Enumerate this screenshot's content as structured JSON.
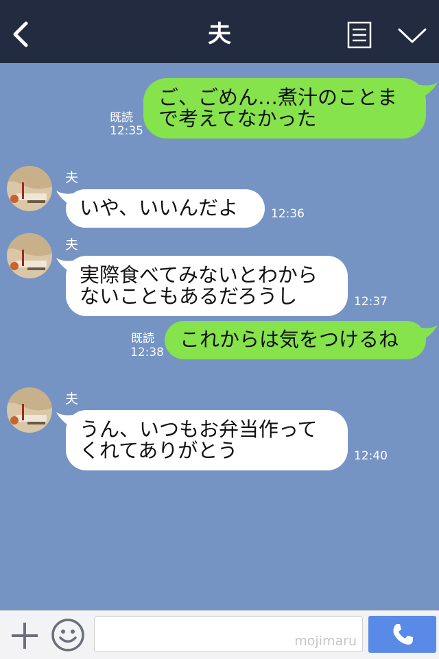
{
  "header": {
    "title": "夫",
    "back_icon": "chevron-left-icon",
    "notes_icon": "notes-icon",
    "more_icon": "chevron-down-icon"
  },
  "messages": [
    {
      "side": "sent",
      "lines": [
        "ご、ごめん…煮汁のことま",
        "で考えてなかった"
      ],
      "read": "既読",
      "time": "12:35"
    },
    {
      "side": "received",
      "sender": "夫",
      "lines": [
        "いや、いいんだよ"
      ],
      "time": "12:36"
    },
    {
      "side": "received",
      "sender": "夫",
      "lines": [
        "実際食べてみないとわから",
        "ないこともあるだろうし"
      ],
      "time": "12:37"
    },
    {
      "side": "sent",
      "lines": [
        "これからは気をつけるね"
      ],
      "read": "既読",
      "time": "12:38"
    },
    {
      "side": "received",
      "sender": "夫",
      "lines": [
        "うん、いつもお弁当作って",
        "くれてありがとう"
      ],
      "time": "12:40"
    }
  ],
  "footer": {
    "input_value": "",
    "watermark": "mojimaru",
    "plus_icon": "plus-icon",
    "emoji_icon": "emoji-icon",
    "call_icon": "phone-icon"
  },
  "colors": {
    "background": "#7594c3",
    "header": "#232b40",
    "sent_bubble": "#86e34c",
    "received_bubble": "#ffffff",
    "call_button": "#5a8ae8"
  }
}
